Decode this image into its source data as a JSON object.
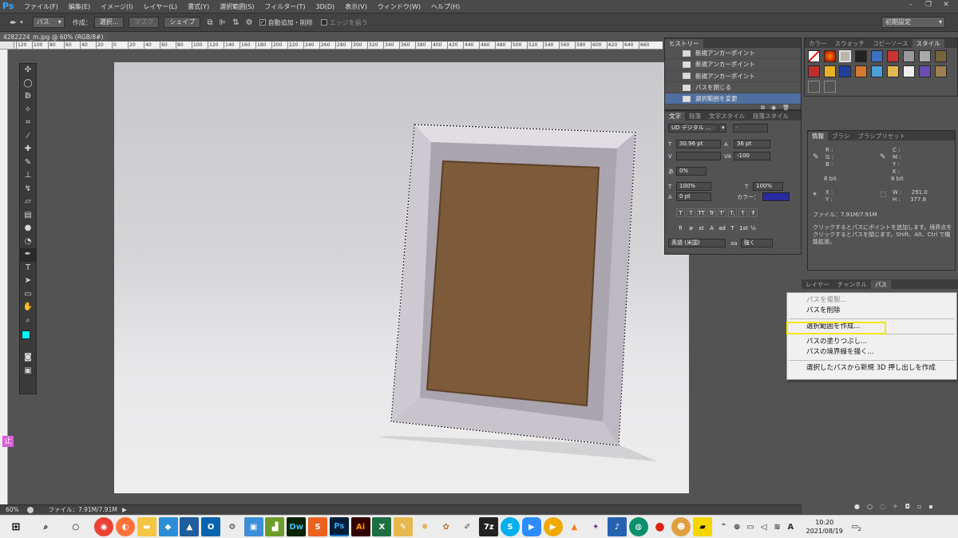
{
  "app": {
    "logo": "Ps"
  },
  "menu": [
    "ファイル(F)",
    "編集(E)",
    "イメージ(I)",
    "レイヤー(L)",
    "書式(Y)",
    "選択範囲(S)",
    "フィルター(T)",
    "3D(D)",
    "表示(V)",
    "ウィンドウ(W)",
    "ヘルプ(H)"
  ],
  "options": {
    "mode": "パス",
    "make_label": "作成：",
    "select_btn": "選択...",
    "mask_btn": "マスク",
    "shape_btn": "シェイプ",
    "auto_add_label": "自動追加・削除",
    "align_edges_label": "エッジを揃う",
    "workspace": "初期設定"
  },
  "document": {
    "tab": "4282224_m.jpg @ 60% (RGB/8#) *",
    "zoom": "60%",
    "file_info": "ファイル：7.91M/7.91M",
    "ruler_top": [
      "120",
      "100",
      "80",
      "60",
      "40",
      "20",
      "0",
      "20",
      "40",
      "60",
      "80",
      "100",
      "120",
      "140",
      "160",
      "180",
      "200",
      "220",
      "240",
      "260",
      "280",
      "300",
      "320",
      "340",
      "360",
      "380",
      "400",
      "420",
      "440",
      "460",
      "480",
      "500",
      "520",
      "540",
      "560",
      "580",
      "600",
      "620",
      "640",
      "660"
    ]
  },
  "nav_badge": "止",
  "history": {
    "tab": "ヒストリー",
    "items": [
      "新規アンカーポイント",
      "新規アンカーポイント",
      "新規アンカーポイント",
      "パスを閉じる",
      "選択範囲を変更"
    ]
  },
  "character": {
    "tabs": [
      "文字",
      "段落",
      "文字スタイル",
      "段落スタイル"
    ],
    "font": "UD デジタル ...",
    "style": "-",
    "size": "30.96 pt",
    "leading": "36 pt",
    "kerning": "",
    "tracking": "-100",
    "scale_pct": "0%",
    "vscale": "100%",
    "hscale": "100%",
    "baseline": "0 pt",
    "color_label": "カラー：",
    "type_buttons": [
      "T",
      "T",
      "TT",
      "Tr",
      "T'",
      "T,",
      "T",
      "Ŧ"
    ],
    "ot_buttons": [
      "fi",
      "ø",
      "st",
      "A",
      "ad",
      "T",
      "1st",
      "½"
    ],
    "language": "英語 (米国)",
    "aa_prefix": "aa",
    "antialias": "強く"
  },
  "swatches": {
    "tabs": [
      "カラー",
      "スウォッチ",
      "コピーソース",
      "スタイル"
    ]
  },
  "info": {
    "tabs": [
      "情報",
      "ブラシ",
      "ブラシプリセット"
    ],
    "rgb_labels": [
      "R :",
      "G :",
      "B :"
    ],
    "cmyk_labels": [
      "C :",
      "M :",
      "Y :",
      "K :"
    ],
    "bit_left": "8 bit",
    "bit_right": "8 bit",
    "xy_labels": [
      "X :",
      "Y :"
    ],
    "w_label": "W :",
    "h_label": "H :",
    "w_value": "291.0",
    "h_value": "377.8",
    "file": "ファイル：7.91M/7.91M",
    "hint": "クリックするとパスにポイントを追加します。境界点をクリックするとパスを閉じます。Shift、Alt、Ctrl で機能拡張。"
  },
  "layers": {
    "tabs": [
      "レイヤー",
      "チャンネル",
      "パス"
    ]
  },
  "context_menu": {
    "items": [
      "パスを複製...",
      "パスを削除",
      "選択範囲を作成...",
      "パスの塗りつぶし...",
      "パスの境界線を描く...",
      "選択したパスから新規 3D 押し出しを作成"
    ]
  },
  "taskbar": {
    "time": "10:20",
    "date": "2021/08/19",
    "ime": "A",
    "notif": "2"
  },
  "colors": {
    "fg": "#00ffff",
    "bg": "#ffffff",
    "text_color": "#2a2aa0",
    "highlight": "#f4e600"
  }
}
